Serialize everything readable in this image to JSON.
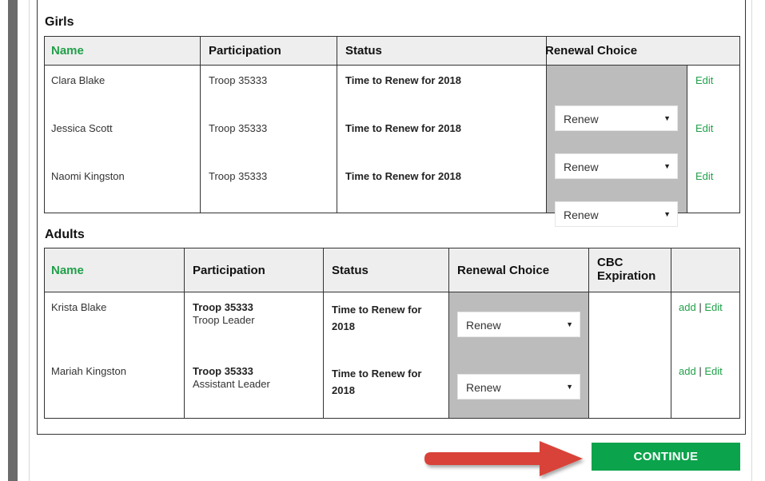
{
  "girls": {
    "title": "Girls",
    "headers": {
      "name": "Name",
      "participation": "Participation",
      "status": "Status",
      "renewal": "Renewal Choice"
    },
    "rows": [
      {
        "name": "Clara Blake",
        "participation": "Troop 35333",
        "status": "Time to Renew for 2018",
        "choice": "Renew",
        "action": "Edit"
      },
      {
        "name": "Jessica Scott",
        "participation": "Troop 35333",
        "status": "Time to Renew for 2018",
        "choice": "Renew",
        "action": "Edit"
      },
      {
        "name": "Naomi Kingston",
        "participation": "Troop 35333",
        "status": "Time to Renew for 2018",
        "choice": "Renew",
        "action": "Edit"
      }
    ]
  },
  "adults": {
    "title": "Adults",
    "headers": {
      "name": "Name",
      "participation": "Participation",
      "status": "Status",
      "renewal": "Renewal Choice",
      "cbc_line1": "CBC",
      "cbc_line2": "Expiration"
    },
    "rows": [
      {
        "name": "Krista Blake",
        "troop": "Troop 35333",
        "role": "Troop Leader",
        "status_line1": "Time to Renew for",
        "status_line2": "2018",
        "choice": "Renew",
        "add": "add",
        "sep": "|",
        "edit": "Edit"
      },
      {
        "name": "Mariah Kingston",
        "troop": "Troop 35333",
        "role": "Assistant Leader",
        "status_line1": "Time to Renew for",
        "status_line2": "2018",
        "choice": "Renew",
        "add": "add",
        "sep": "|",
        "edit": "Edit"
      }
    ]
  },
  "continue_button": "CONTINUE",
  "colors": {
    "accent_green": "#0ba34b",
    "header_green": "#22a04a",
    "arrow_red": "#d94339",
    "choice_bg": "#bcbcbc"
  }
}
